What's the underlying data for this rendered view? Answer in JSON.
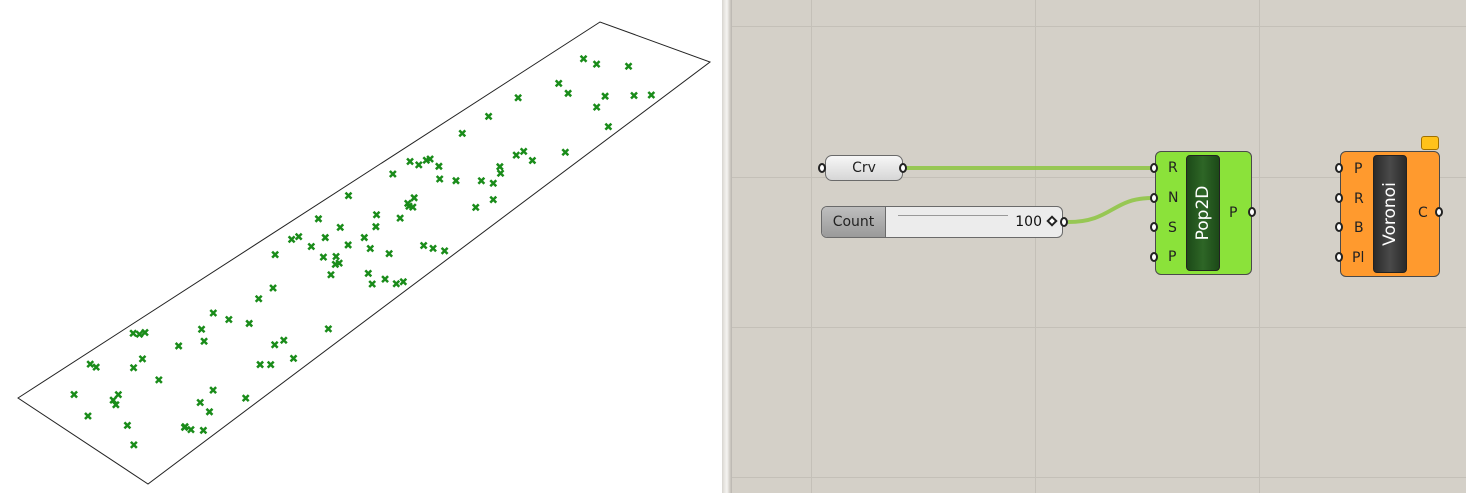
{
  "canvas": {
    "crv_param": {
      "label": "Crv"
    },
    "slider": {
      "label": "Count",
      "value": "100"
    },
    "pop2d": {
      "name": "Pop2D",
      "inputs": [
        "R",
        "N",
        "S",
        "P"
      ],
      "output": "P",
      "color": "#8be23a"
    },
    "voronoi": {
      "name": "Voronoi",
      "inputs": [
        "P",
        "R",
        "B",
        "Pl"
      ],
      "output": "C",
      "color": "#ff9a2e"
    }
  },
  "viewport": {
    "point_count": 100,
    "point_color": "#1a8c1a"
  }
}
